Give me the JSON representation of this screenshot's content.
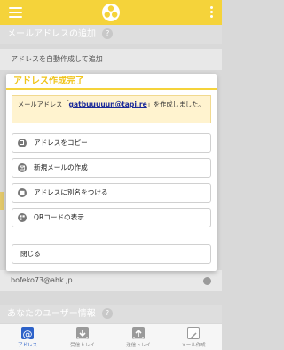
{
  "header": {
    "menu_icon": "hamburger-icon",
    "logo_icon": "tapi-logo-icon",
    "more_icon": "more-vertical-icon"
  },
  "background": {
    "section_email_add": "メールアドレスの追加",
    "auto_create_row": "アドレスを自動作成して追加",
    "address_row": "bofeko73@ahk.jp",
    "section_user_info": "あなたのユーザー情報",
    "help_glyph": "?"
  },
  "dialog": {
    "title": "アドレス作成完了",
    "notice_prefix": "メールアドレス「",
    "notice_email": "gatbuuuuun@tapi.re",
    "notice_suffix": "」を作成しました。",
    "buttons": [
      {
        "label": "アドレスをコピー",
        "icon": "copy-icon"
      },
      {
        "label": "新規メールの作成",
        "icon": "compose-icon"
      },
      {
        "label": "アドレスに別名をつける",
        "icon": "rename-icon"
      },
      {
        "label": "QRコードの表示",
        "icon": "qr-icon"
      }
    ],
    "close_label": "閉じる"
  },
  "nav": {
    "items": [
      {
        "label": "アドレス",
        "icon": "at-icon",
        "active": true
      },
      {
        "label": "受信トレイ",
        "icon": "inbox-icon",
        "active": false
      },
      {
        "label": "送信トレイ",
        "icon": "outbox-icon",
        "active": false
      },
      {
        "label": "メール作成",
        "icon": "compose-icon",
        "active": false
      }
    ]
  },
  "colors": {
    "accent": "#f5d33a",
    "nav_active": "#2d62c9",
    "notice_bg": "#fff3cf"
  }
}
